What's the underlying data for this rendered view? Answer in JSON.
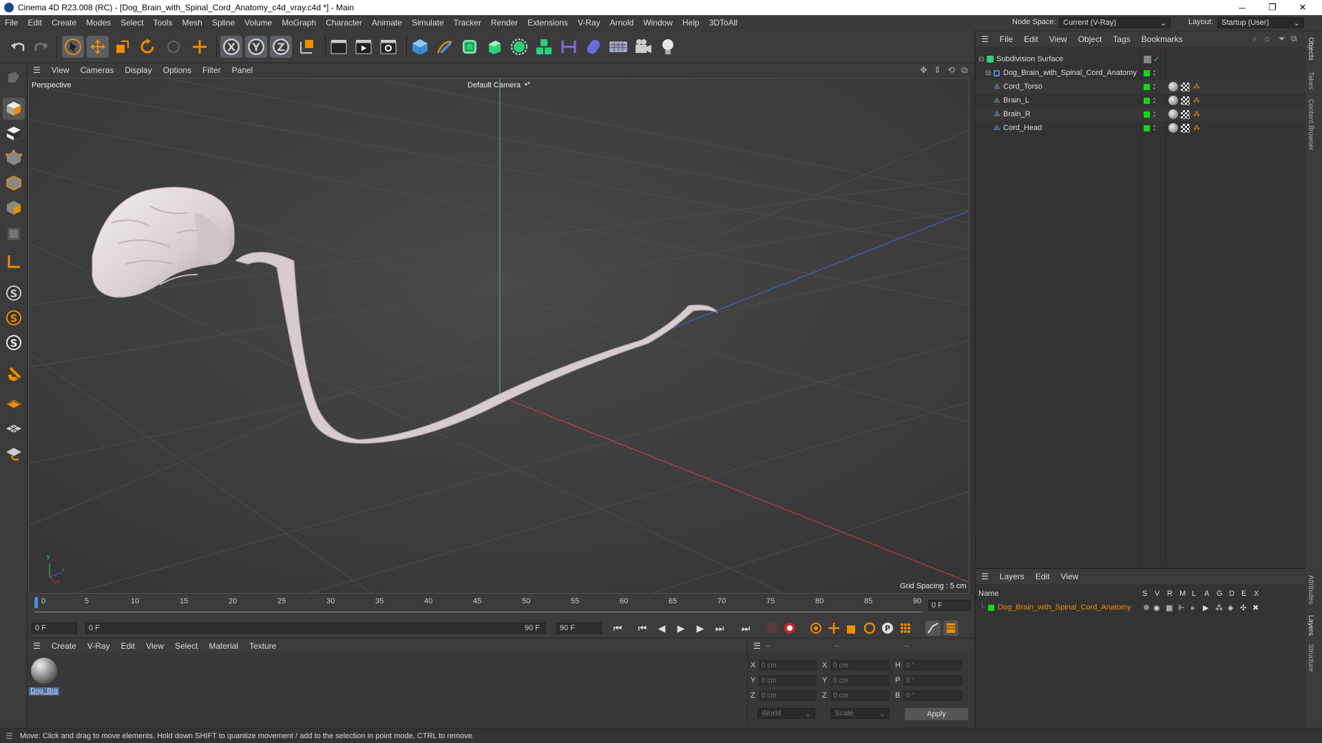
{
  "titlebar": {
    "title": "Cinema 4D R23.008 (RC) - [Dog_Brain_with_Spinal_Cord_Anatomy_c4d_vray.c4d *] - Main",
    "minimize": "─",
    "maximize": "❐",
    "close": "✕"
  },
  "menubar": {
    "items": [
      "File",
      "Edit",
      "Create",
      "Modes",
      "Select",
      "Tools",
      "Mesh",
      "Spline",
      "Volume",
      "MoGraph",
      "Character",
      "Animate",
      "Simulate",
      "Tracker",
      "Render",
      "Extensions",
      "V-Ray",
      "Arnold",
      "Window",
      "Help",
      "3DToAll"
    ],
    "node_space_label": "Node Space:",
    "node_space_value": "Current (V-Ray)",
    "layout_label": "Layout:",
    "layout_value": "Startup (User)"
  },
  "viewport": {
    "menu": [
      "View",
      "Cameras",
      "Display",
      "Options",
      "Filter",
      "Panel"
    ],
    "label": "Perspective",
    "camera": "Default Camera",
    "camera_icon": "•*",
    "grid_spacing": "Grid Spacing : 5 cm",
    "axis_y": "y",
    "axis_z": "z",
    "axis_x": "x"
  },
  "timeline": {
    "ticks": [
      "0",
      "5",
      "10",
      "15",
      "20",
      "25",
      "30",
      "35",
      "40",
      "45",
      "50",
      "55",
      "60",
      "65",
      "70",
      "75",
      "80",
      "85",
      "90"
    ],
    "end_field": "0 F",
    "start_field": "0 F",
    "current_field": "0 F",
    "range_end_label": "90 F",
    "max_field": "90 F",
    "current_frame": 0
  },
  "material_panel": {
    "menu": [
      "Create",
      "V-Ray",
      "Edit",
      "View",
      "Select",
      "Material",
      "Texture"
    ],
    "material_name": "Dog_Bra"
  },
  "coord_panel": {
    "headers": [
      "--",
      "--",
      "--"
    ],
    "rows": [
      {
        "a_label": "X",
        "a_val": "0 cm",
        "b_label": "X",
        "b_val": "0 cm",
        "c_label": "H",
        "c_val": "0 °"
      },
      {
        "a_label": "Y",
        "a_val": "0 cm",
        "b_label": "Y",
        "b_val": "0 cm",
        "c_label": "P",
        "c_val": "0 °"
      },
      {
        "a_label": "Z",
        "a_val": "0 cm",
        "b_label": "Z",
        "b_val": "0 cm",
        "c_label": "B",
        "c_val": "0 °"
      }
    ],
    "world": "World",
    "scale": "Scale",
    "apply": "Apply"
  },
  "object_manager": {
    "menu": [
      "File",
      "Edit",
      "View",
      "Object",
      "Tags",
      "Bookmarks"
    ],
    "objects": [
      {
        "name": "Subdivision Surface"
      },
      {
        "name": "Dog_Brain_with_Spinal_Cord_Anatomy"
      },
      {
        "name": "Cord_Torso"
      },
      {
        "name": "Brain_L"
      },
      {
        "name": "Brain_R"
      },
      {
        "name": "Cord_Head"
      }
    ]
  },
  "layer_manager": {
    "menu": [
      "Layers",
      "Edit",
      "View"
    ],
    "name_header": "Name",
    "col_headers": [
      "S",
      "V",
      "R",
      "M",
      "L",
      "A",
      "G",
      "D",
      "E",
      "X"
    ],
    "layer_name": "Dog_Brain_with_Spinal_Cord_Anatomy"
  },
  "right_tabs": [
    "Objects",
    "Takes",
    "Content Browser",
    "Attributes",
    "Layers",
    "Structure"
  ],
  "statusbar": {
    "text": "Move: Click and drag to move elements. Hold down SHIFT to quantize movement / add to the selection in point mode, CTRL to remove."
  },
  "colors": {
    "accent_orange": "#f08c00",
    "layer_green": "#12d912",
    "axis_x": "#c83c3c",
    "axis_y": "#3cc86e",
    "axis_z": "#3c64c8"
  }
}
